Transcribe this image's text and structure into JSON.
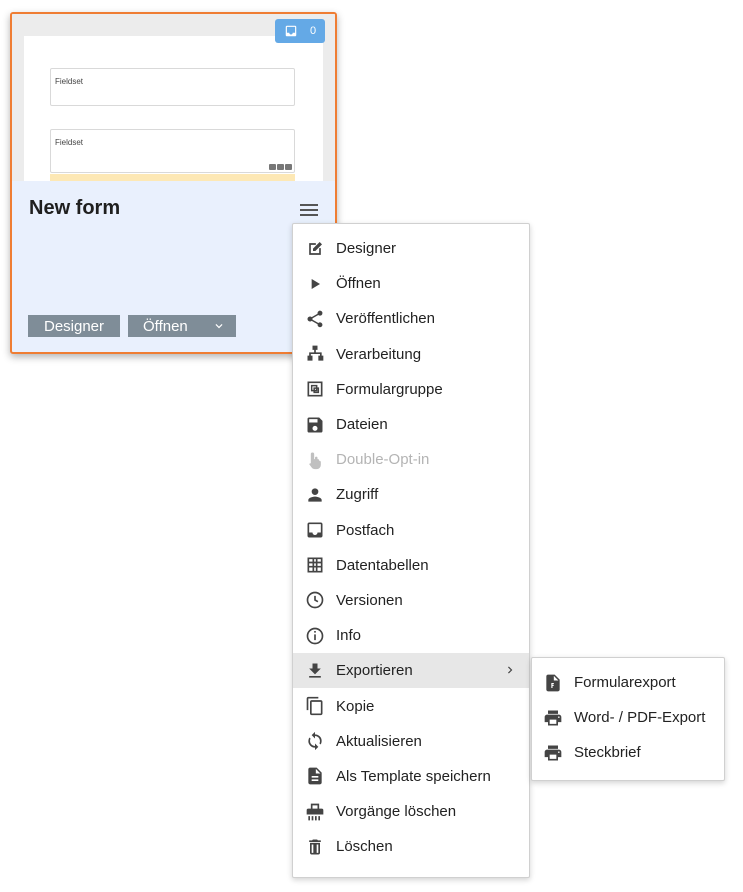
{
  "card": {
    "title": "New form",
    "badge_count": "0",
    "preview": {
      "fieldset_1": "Fieldset",
      "fieldset_2": "Fieldset"
    },
    "buttons": {
      "designer": "Designer",
      "open": "Öffnen"
    },
    "colors": {
      "border": "#ef7d33",
      "background": "#e9f0fd",
      "badge": "#64a9e6",
      "button": "#7f8d98"
    }
  },
  "menu": {
    "items": [
      {
        "label": "Designer",
        "icon": "edit-icon"
      },
      {
        "label": "Öffnen",
        "icon": "play-icon"
      },
      {
        "label": "Veröffentlichen",
        "icon": "share-icon"
      },
      {
        "label": "Verarbeitung",
        "icon": "sitemap-icon"
      },
      {
        "label": "Formulargruppe",
        "icon": "group-icon"
      },
      {
        "label": "Dateien",
        "icon": "save-icon"
      },
      {
        "label": "Double-Opt-in",
        "icon": "touch-icon",
        "disabled": true
      },
      {
        "label": "Zugriff",
        "icon": "person-icon"
      },
      {
        "label": "Postfach",
        "icon": "inbox-icon"
      },
      {
        "label": "Datentabellen",
        "icon": "table-icon"
      },
      {
        "label": "Versionen",
        "icon": "clock-icon"
      },
      {
        "label": "Info",
        "icon": "info-icon"
      },
      {
        "label": "Exportieren",
        "icon": "download-icon",
        "active": true,
        "has_submenu": true
      },
      {
        "label": "Kopie",
        "icon": "copy-icon"
      },
      {
        "label": "Aktualisieren",
        "icon": "refresh-icon"
      },
      {
        "label": "Als Template speichern",
        "icon": "file-icon"
      },
      {
        "label": "Vorgänge löschen",
        "icon": "shredder-icon"
      },
      {
        "label": "Löschen",
        "icon": "trash-icon"
      }
    ]
  },
  "submenu": {
    "items": [
      {
        "label": "Formularexport",
        "icon": "file-export-icon"
      },
      {
        "label": "Word- / PDF-Export",
        "icon": "print-icon"
      },
      {
        "label": "Steckbrief",
        "icon": "print-icon"
      }
    ]
  }
}
